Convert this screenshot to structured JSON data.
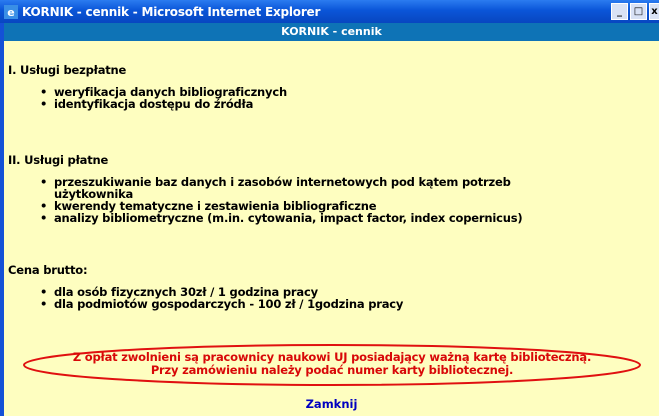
{
  "window": {
    "title": "KORNIK - cennik - Microsoft Internet Explorer",
    "minimize_glyph": "_",
    "maximize_glyph": "□",
    "close_glyph": "x"
  },
  "page": {
    "header": "KORNIK - cennik",
    "section1": {
      "title": "I. Usługi bezpłatne",
      "items": [
        "weryfikacja danych bibliograficznych",
        "identyfikacja dostępu do źródła"
      ]
    },
    "section2": {
      "title": "II. Usługi płatne",
      "items": [
        "przeszukiwanie baz danych i zasobów internetowych pod kątem potrzeb",
        "użytkownika",
        "kwerendy tematyczne i zestawienia bibliograficzne",
        "analizy bibliometryczne (m.in. cytowania, impact factor, index copernicus)"
      ]
    },
    "section3": {
      "title": "Cena brutto:",
      "items": [
        "dla osób fizycznych 30zł / 1 godzina pracy",
        "dla podmiotów gospodarczych - 100 zł / 1godzina pracy"
      ]
    },
    "notice": {
      "line1": "Z opłat zwolnieni są pracownicy naukowi UJ posiadający ważną kartę biblioteczną.",
      "line2": "Przy zamówieniu należy podać numer karty bibliotecznej."
    },
    "close_link": "Zamknij"
  },
  "colors": {
    "titlebar": "#0a55d8",
    "header_bar": "#0e73b6",
    "content_bg": "#fefec0",
    "notice_text": "#d80808",
    "link": "#0000c0"
  }
}
